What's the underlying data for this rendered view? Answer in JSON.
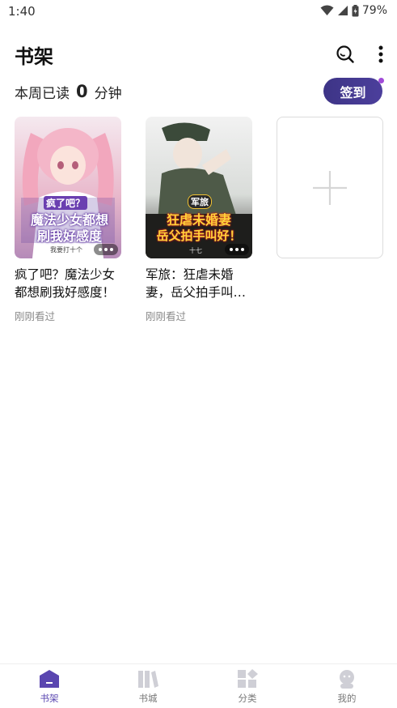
{
  "status": {
    "time": "1:40",
    "battery": "79%"
  },
  "header": {
    "title": "书架"
  },
  "reading": {
    "prefix": "本周已读",
    "minutes": "0",
    "suffix": "分钟"
  },
  "checkin": {
    "label": "签到"
  },
  "books": [
    {
      "title": "疯了吧？魔法少女都想刷我好感度！",
      "status": "刚刚看过",
      "cover_text_top": "疯了吧？",
      "cover_text_main1": "魔法少女都想",
      "cover_text_main2": "刷我好感度",
      "cover_author": "我要打十个"
    },
    {
      "title": "军旅：狂虐未婚妻，岳父拍手叫好！",
      "status": "刚刚看过",
      "cover_tag": "军旅",
      "cover_text_main1": "狂虐未婚妻",
      "cover_text_main2": "岳父拍手叫好！",
      "cover_author": "十七"
    }
  ],
  "tabs": [
    {
      "label": "书架",
      "icon": "bookshelf-icon",
      "active": true
    },
    {
      "label": "书城",
      "icon": "bookstore-icon"
    },
    {
      "label": "分类",
      "icon": "category-icon"
    },
    {
      "label": "我的",
      "icon": "profile-icon"
    }
  ],
  "colors": {
    "accent": "#4c3f9c",
    "dot": "#a14bd8"
  }
}
